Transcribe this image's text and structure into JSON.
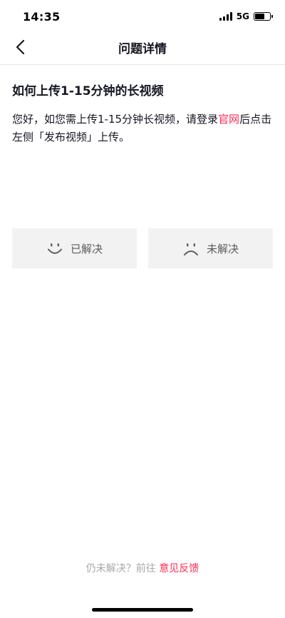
{
  "status_bar": {
    "time": "14:35",
    "network": "5G",
    "battery_level": 0.65,
    "icons": [
      "signal-icon",
      "battery-icon"
    ]
  },
  "nav": {
    "title": "问题详情",
    "back_icon": "chevron-left-icon"
  },
  "article": {
    "title": "如何上传1-15分钟的长视频",
    "body_before_link": "您好，如您需上传1-15分钟长视频，请登录",
    "link_text": "官网",
    "body_after_link": "后点击左侧「发布视频」上传。"
  },
  "feedback": {
    "resolved_label": "已解决",
    "resolved_icon": "smile-face-icon",
    "unresolved_label": "未解决",
    "unresolved_icon": "sad-face-icon"
  },
  "footer": {
    "prefix": "仍未解决？前往 ",
    "link_text": "意见反馈"
  },
  "colors": {
    "accent": "#fe2c55",
    "text": "#161823",
    "button_bg": "#f2f2f2",
    "muted": "#a8a8a8"
  }
}
